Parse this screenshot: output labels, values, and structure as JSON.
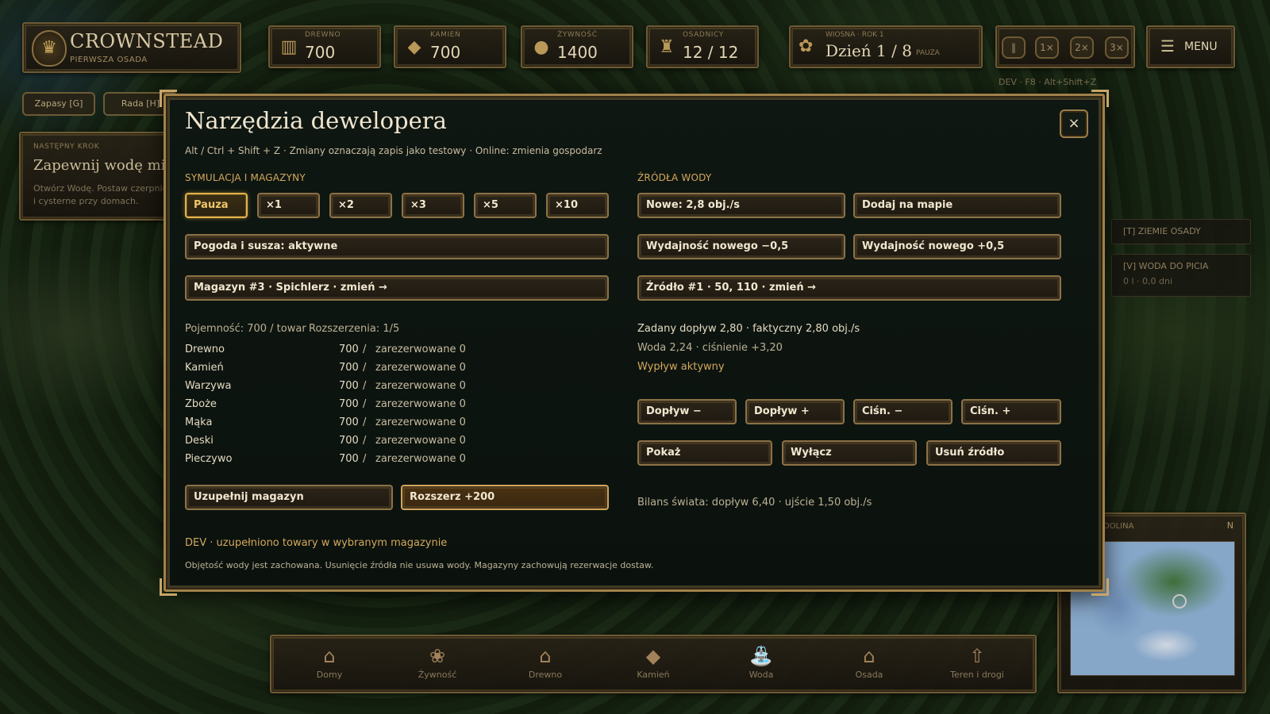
{
  "hud": {
    "brand_title": "CROWNSTEAD",
    "brand_subtitle": "PIERWSZA OSADA",
    "resources": [
      {
        "label": "DREWNO",
        "value": "700",
        "icon": "log-icon"
      },
      {
        "label": "KAMIEŃ",
        "value": "700",
        "icon": "stone-icon"
      },
      {
        "label": "ŻYWNOŚĆ",
        "value": "1400",
        "icon": "bread-icon"
      },
      {
        "label": "OSADNICY",
        "value": "12 / 12",
        "icon": "settlers-icon"
      }
    ],
    "season": "WIOSNA · ROK 1",
    "day": "Dzień 1 / 8",
    "pause_label": "PAUZA",
    "speeds": [
      "1×",
      "2×",
      "3×"
    ],
    "menu_label": "MENU",
    "dev_hint": "DEV · F8 · Alt+Shift+Z"
  },
  "left_panel": {
    "supplies_label": "Zapasy [G]",
    "council_label": "Rada [H]",
    "next_step_label": "NASTĘPNY KROK",
    "next_step_title": "Zapewnij wodę mie",
    "next_step_desc": "Otwórz Wodę. Postaw czerpnie i cysterne przy domach."
  },
  "right_panel": {
    "lands_label": "[T] ZIEMIE OSADY",
    "water_label": "[V] WODA DO PICIA",
    "water_value": "0 l · 0,0 dni",
    "minimap_label": "DOLINA",
    "minimap_north": "N"
  },
  "build_bar": [
    {
      "label": "Domy",
      "icon": "house-icon"
    },
    {
      "label": "Żywność",
      "icon": "farm-icon"
    },
    {
      "label": "Drewno",
      "icon": "lumber-icon"
    },
    {
      "label": "Kamień",
      "icon": "quarry-icon"
    },
    {
      "label": "Woda",
      "icon": "well-icon"
    },
    {
      "label": "Osada",
      "icon": "settlement-icon"
    },
    {
      "label": "Teren i drogi",
      "icon": "terrain-icon"
    }
  ],
  "dev": {
    "title": "Narzędzia dewelopera",
    "subtitle": "Alt / Ctrl + Shift + Z  ·  Zmiany oznaczają zapis jako testowy  ·  Online: zmienia gospodarz",
    "close_label": "×",
    "sim_section": "SYMULACJA I MAGAZYNY",
    "speed_buttons": [
      "Pauza",
      "×1",
      "×2",
      "×3",
      "×5",
      "×10"
    ],
    "active_speed": "Pauza",
    "weather_button": "Pogoda i susza: aktywne",
    "warehouse_button": "Magazyn #3 · Spichlerz · zmień →",
    "capacity": "Pojemność: 700 / towar",
    "expansions": "Rozszerzenia: 1/5",
    "stock": [
      {
        "name": "Drewno",
        "qty": "700",
        "reserved": "zarezerwowane 0"
      },
      {
        "name": "Kamień",
        "qty": "700",
        "reserved": "zarezerwowane 0"
      },
      {
        "name": "Warzywa",
        "qty": "700",
        "reserved": "zarezerwowane 0"
      },
      {
        "name": "Zboże",
        "qty": "700",
        "reserved": "zarezerwowane 0"
      },
      {
        "name": "Mąka",
        "qty": "700",
        "reserved": "zarezerwowane 0"
      },
      {
        "name": "Deski",
        "qty": "700",
        "reserved": "zarezerwowane 0"
      },
      {
        "name": "Pieczywo",
        "qty": "700",
        "reserved": "zarezerwowane 0"
      }
    ],
    "fill_button": "Uzupełnij magazyn",
    "expand_button": "Rozszerz +200",
    "status_message": "DEV · uzupełniono towary w wybranym magazynie",
    "footer_note": "Objętość wody jest zachowana. Usunięcie źródła nie usuwa wody. Magazyny zachowują rezerwacje dostaw.",
    "water_section": "ŹRÓDŁA WODY",
    "new_source_button": "Nowe: 2,8 obj./s",
    "add_on_map_button": "Dodaj na mapie",
    "yield_minus_button": "Wydajność nowego −0,5",
    "yield_plus_button": "Wydajność nowego +0,5",
    "source_button": "Źródło #1 · 50, 110 · zmień →",
    "inflow_info": "Zadany dopływ 2,80 · faktyczny 2,80 obj./s",
    "water_info": "Woda 2,24 · ciśnienie +3,20",
    "outflow_status": "Wypływ aktywny",
    "inflow_minus": "Dopływ −",
    "inflow_plus": "Dopływ +",
    "pressure_minus": "Ciśn. −",
    "pressure_plus": "Ciśn. +",
    "show_button": "Pokaż",
    "disable_button": "Wyłącz",
    "remove_button": "Usuń źródło",
    "world_balance": "Bilans świata: dopływ 6,40 · ujście 1,50 obj./s"
  }
}
